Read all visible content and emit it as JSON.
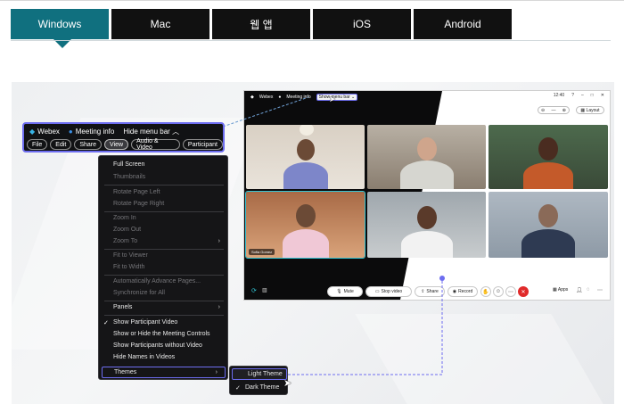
{
  "tabs": [
    {
      "label": "Windows",
      "active": true
    },
    {
      "label": "Mac",
      "active": false
    },
    {
      "label": "웹 앱",
      "active": false
    },
    {
      "label": "iOS",
      "active": false
    },
    {
      "label": "Android",
      "active": false
    }
  ],
  "meeting_window": {
    "app_name": "Webex",
    "meeting_info": "Meeting info",
    "show_menu_bar": "Show menu bar",
    "clock": "12:40",
    "layout_label": "Layout",
    "name_tag": "Sofia Gomez",
    "controls": {
      "mute": "Mute",
      "stop_video": "Stop video",
      "share": "Share",
      "record": "Record",
      "apps": "Apps"
    }
  },
  "menu_bar": {
    "app_name": "Webex",
    "meeting_info": "Meeting info",
    "hide_menu_bar": "Hide menu bar",
    "buttons": [
      "File",
      "Edit",
      "Share",
      "View",
      "Audio & Video",
      "Participant"
    ],
    "selected": "View"
  },
  "view_menu": {
    "items": [
      {
        "label": "Full Screen",
        "enabled": true
      },
      {
        "label": "Thumbnails",
        "enabled": false
      },
      {
        "label": "Rotate Page Left",
        "enabled": false
      },
      {
        "label": "Rotate Page Right",
        "enabled": false
      },
      {
        "label": "Zoom In",
        "enabled": false
      },
      {
        "label": "Zoom Out",
        "enabled": false
      },
      {
        "label": "Zoom To",
        "enabled": false
      },
      {
        "label": "Fit to Viewer",
        "enabled": false
      },
      {
        "label": "Fit to Width",
        "enabled": false
      },
      {
        "label": "Automatically Advance Pages...",
        "enabled": false
      },
      {
        "label": "Synchronize for All",
        "enabled": false
      },
      {
        "label": "Panels",
        "enabled": true
      },
      {
        "label": "Show Participant Video",
        "enabled": true,
        "checked": true
      },
      {
        "label": "Show or Hide the Meeting Controls",
        "enabled": true
      },
      {
        "label": "Show Participants without Video",
        "enabled": true
      },
      {
        "label": "Hide Names in Videos",
        "enabled": true
      },
      {
        "label": "Themes",
        "enabled": true
      }
    ]
  },
  "themes_submenu": {
    "items": [
      {
        "label": "Light Theme",
        "checked": false
      },
      {
        "label": "Dark Theme",
        "checked": true
      }
    ]
  },
  "colors": {
    "tab_active": "#10707f",
    "tab_inactive": "#111111",
    "highlight_outline": "#6d6df0",
    "end_call": "#e02a2a"
  }
}
